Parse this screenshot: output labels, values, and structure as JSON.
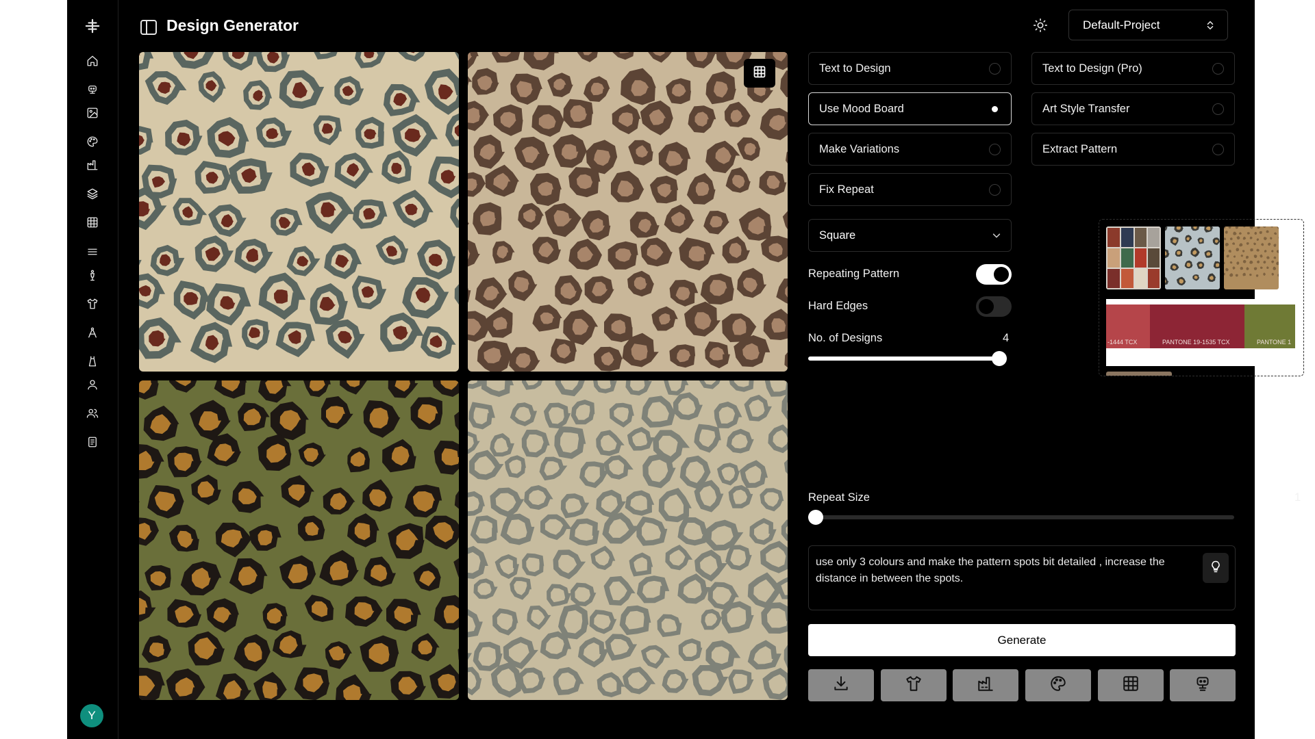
{
  "header": {
    "title": "Design Generator",
    "project": "Default-Project"
  },
  "sidebar": {
    "avatar_initial": "Y",
    "icons": [
      "logo-icon",
      "home-icon",
      "robot-icon",
      "image-icon",
      "palette-icon",
      "factory-icon",
      "layers-icon",
      "grid-icon",
      "menu-icon",
      "mannequin-icon",
      "shirt-icon",
      "compass-icon",
      "dress-icon",
      "user-icon",
      "users-icon",
      "document-icon"
    ]
  },
  "modes": [
    {
      "label": "Text to Design",
      "selected": false
    },
    {
      "label": "Text to Design (Pro)",
      "selected": false
    },
    {
      "label": "Use Mood Board",
      "selected": true
    },
    {
      "label": "Art Style Transfer",
      "selected": false
    },
    {
      "label": "Make Variations",
      "selected": false
    },
    {
      "label": "Extract Pattern",
      "selected": false
    },
    {
      "label": "Fix Repeat",
      "selected": false
    }
  ],
  "settings": {
    "shape": "Square",
    "repeating_pattern_label": "Repeating Pattern",
    "repeating_pattern_on": true,
    "hard_edges_label": "Hard Edges",
    "hard_edges_on": false,
    "num_designs_label": "No. of Designs",
    "num_designs_value": "4",
    "num_designs_fraction": 1.0,
    "repeat_size_label": "Repeat Size",
    "repeat_size_value": "1",
    "repeat_size_fraction": 0.0
  },
  "mood_board": {
    "palette": [
      {
        "hex": "#b5454a",
        "label": "-1444 TCX"
      },
      {
        "hex": "#8d2535",
        "label": "PANTONE 19-1535 TCX"
      },
      {
        "hex": "#6f7a35",
        "label": "PANTONE 1"
      }
    ]
  },
  "prompt": {
    "text": "use only 3 colours and make the pattern spots bit detailed , increase the distance in between the spots."
  },
  "actions": {
    "generate_label": "Generate",
    "tools": [
      "download-icon",
      "shirt-icon",
      "factory-icon",
      "palette-icon",
      "grid-icon",
      "robot-icon"
    ]
  },
  "colors": {
    "background": "#000000",
    "tile1_bg": "#d6c8a8",
    "tile1_ring": "#5a6660",
    "tile1_core": "#6a2a1e",
    "tile2_bg": "#c9b799",
    "tile2_ring": "#5c4435",
    "tile2_core": "#a8856a",
    "tile3_bg": "#6a6f3a",
    "tile3_ring": "#1e1814",
    "tile3_core": "#b07a2e",
    "tile4_bg": "#c7bc9f",
    "tile4_ring": "#7f8278"
  }
}
